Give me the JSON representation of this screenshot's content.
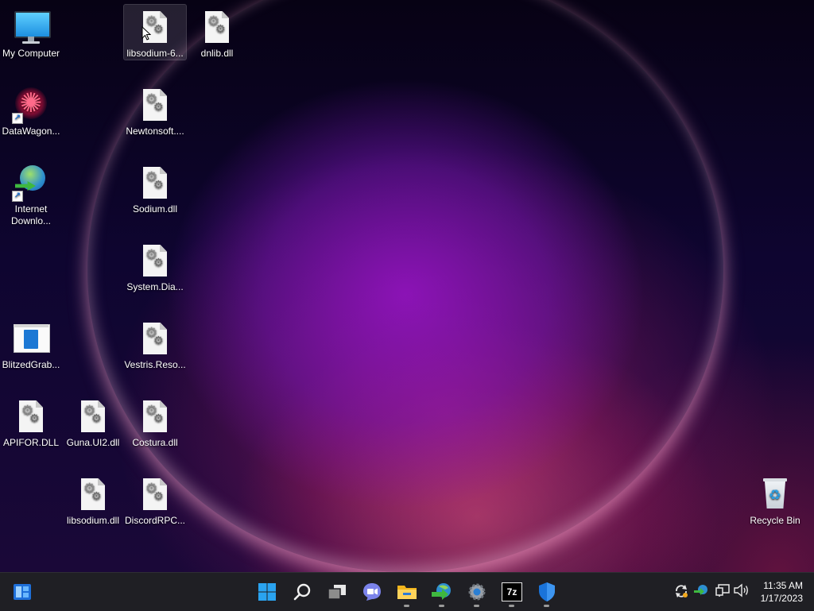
{
  "desktop_icons": {
    "my_computer": "My Computer",
    "datawagon": "DataWagon...",
    "internet_download": "Internet Downlo...",
    "blitzedgrab": "BlitzedGrab...",
    "apifor": "APIFOR.DLL",
    "guna": "Guna.UI2.dll",
    "costura": "Costura.dll",
    "libsodium_dll": "libsodium.dll",
    "discordrpc": "DiscordRPC...",
    "libsodium_6": "libsodium-6...",
    "dnlib": "dnlib.dll",
    "newtonsoft": "Newtonsoft....",
    "sodium": "Sodium.dll",
    "system_dia": "System.Dia...",
    "vestris": "Vestris.Reso...",
    "recycle_bin": "Recycle Bin"
  },
  "taskbar": {
    "apps": [
      "start-icon",
      "search-icon",
      "task-view-icon",
      "chat-icon",
      "file-explorer-icon",
      "internet-download-manager-icon",
      "settings-icon",
      "7zip-icon",
      "windows-security-icon"
    ],
    "sevenzip_label": "7z",
    "clock_time": "11:35 AM",
    "clock_date": "1/17/2023"
  },
  "colors": {
    "taskbar_bg": "#1f1f24",
    "accent_blue": "#2aa3f0"
  }
}
